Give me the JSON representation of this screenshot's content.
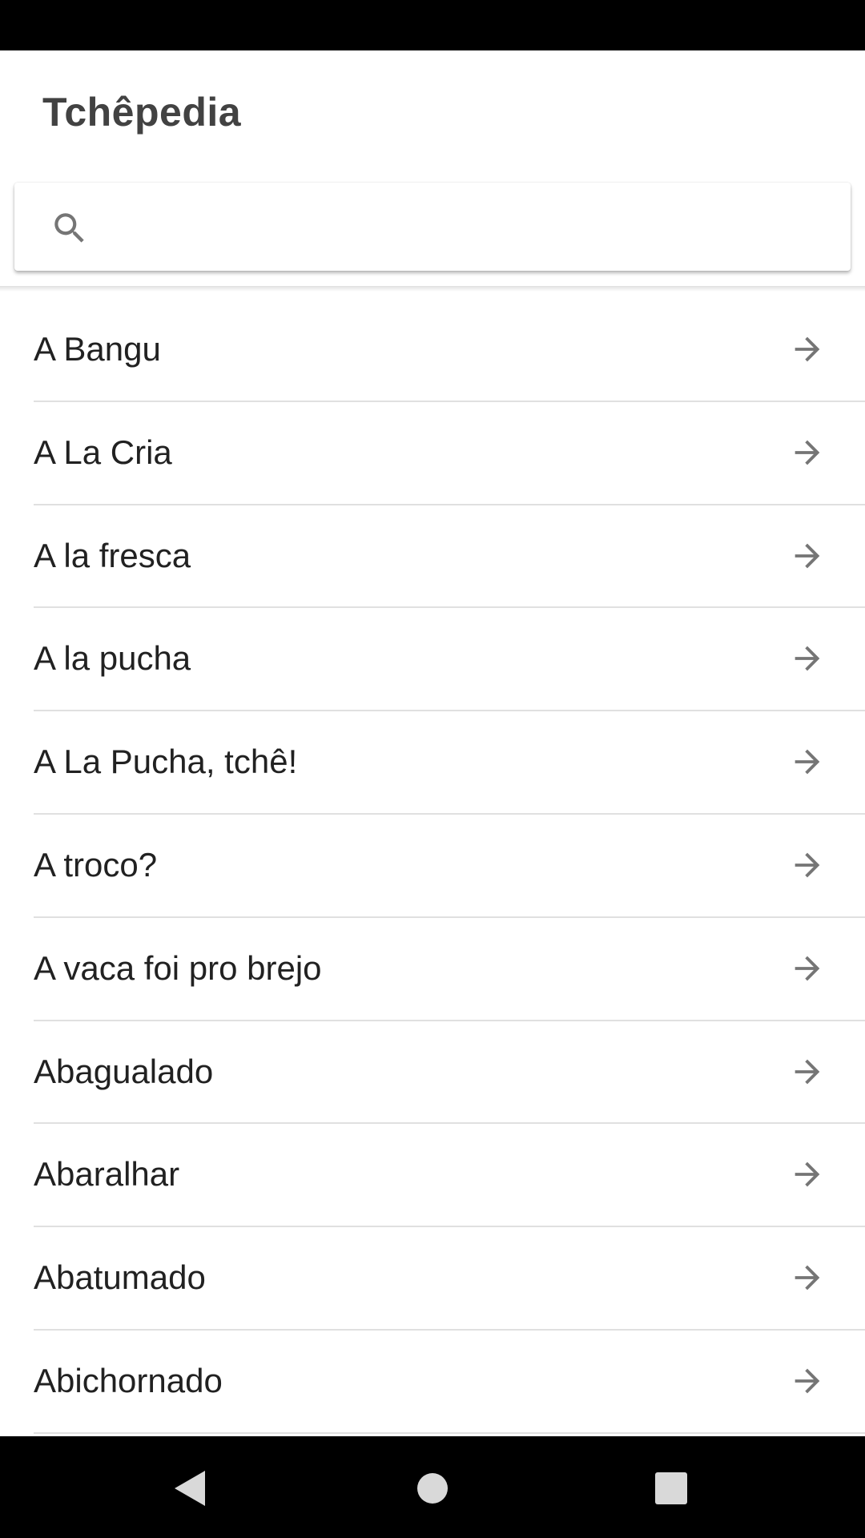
{
  "app": {
    "title": "Tchêpedia"
  },
  "search": {
    "placeholder": "",
    "value": "",
    "icon": "search-icon"
  },
  "list": {
    "items": [
      {
        "label": "A Bangu"
      },
      {
        "label": "A La Cria"
      },
      {
        "label": "A la fresca"
      },
      {
        "label": "A la pucha"
      },
      {
        "label": "A La Pucha, tchê!"
      },
      {
        "label": "A troco?"
      },
      {
        "label": "A vaca foi pro brejo"
      },
      {
        "label": "Abagualado"
      },
      {
        "label": "Abaralhar"
      },
      {
        "label": "Abatumado"
      },
      {
        "label": "Abichornado"
      }
    ],
    "item_icon": "arrow-right-icon"
  },
  "navigation": {
    "buttons": [
      "back",
      "home",
      "recents"
    ]
  },
  "colors": {
    "title": "#424242",
    "text": "#212121",
    "icon": "#757575",
    "divider": "#e0e0e0",
    "system_bars": "#000000"
  }
}
